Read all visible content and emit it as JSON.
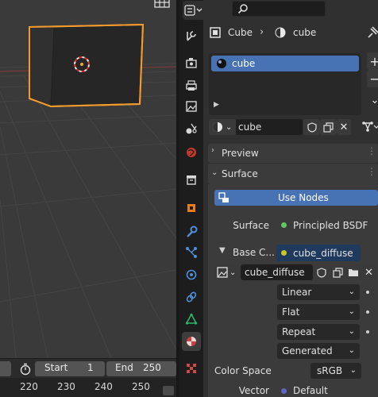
{
  "viewport": {
    "timeline": {
      "start_label": "Start",
      "start_value": "1",
      "end_label": "End",
      "end_value": "250"
    },
    "ruler_numbers": [
      "220",
      "230",
      "240",
      "250"
    ]
  },
  "header": {
    "object_name": "Cube",
    "material_name": "cube"
  },
  "material_slots": [
    {
      "name": "cube",
      "selected": true
    }
  ],
  "material_selector": {
    "name": "cube"
  },
  "panels": {
    "preview": {
      "label": "Preview",
      "expanded": false
    },
    "surface": {
      "label": "Surface",
      "expanded": true
    }
  },
  "surface": {
    "use_nodes_label": "Use Nodes",
    "surface_label": "Surface",
    "surface_value": "Principled BSDF",
    "base_color_label": "Base C...",
    "base_color_value": "cube_diffuse",
    "image_name": "cube_diffuse",
    "interpolation": "Linear",
    "projection": "Flat",
    "extension": "Repeat",
    "source": "Generated",
    "color_space_label": "Color Space",
    "color_space_value": "sRGB",
    "vector_label": "Vector",
    "vector_value": "Default"
  },
  "colors": {
    "accent_blue": "#4772b3",
    "socket_green": "#63c763",
    "socket_yellow": "#c7c729",
    "socket_purple": "#6363c7",
    "selection_orange": "#f29a2e"
  }
}
